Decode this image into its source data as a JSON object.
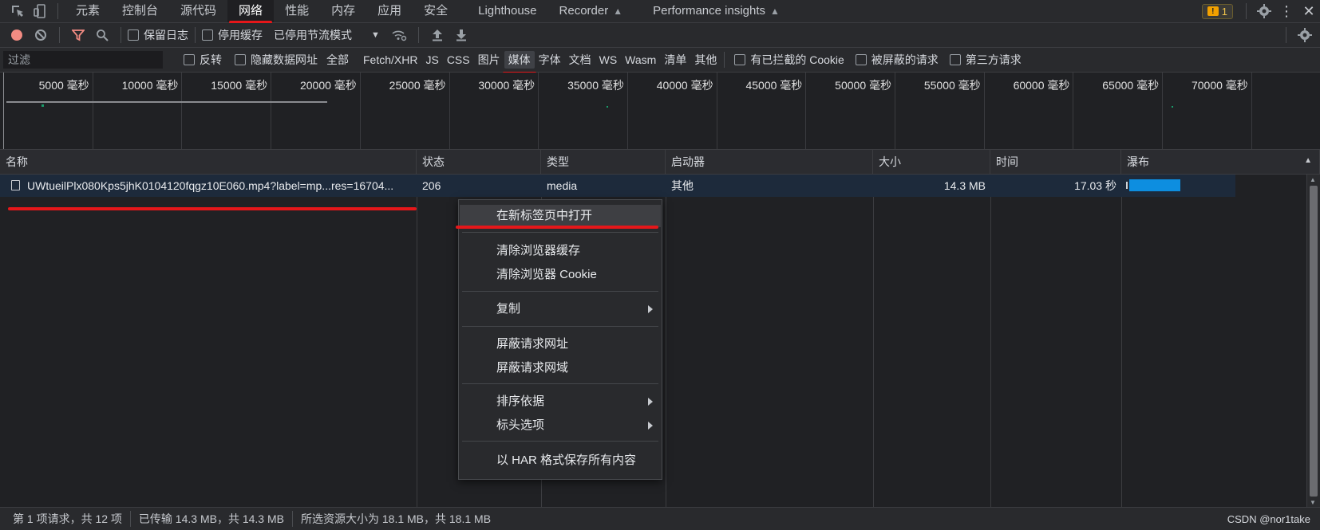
{
  "tabs": [
    "元素",
    "控制台",
    "源代码",
    "网络",
    "性能",
    "内存",
    "应用",
    "安全",
    "Lighthouse",
    "Recorder",
    "Performance insights"
  ],
  "active_tab_index": 3,
  "issues_count": "1",
  "toolbar": {
    "preserve_log": "保留日志",
    "disable_cache": "停用缓存",
    "throttling": "已停用节流模式"
  },
  "filter": {
    "placeholder": "过滤",
    "invert": "反转",
    "hide_data_urls": "隐藏数据网址",
    "types": [
      "全部",
      "Fetch/XHR",
      "JS",
      "CSS",
      "图片",
      "媒体",
      "字体",
      "文档",
      "WS",
      "Wasm",
      "清单",
      "其他"
    ],
    "active_type_index": 5,
    "blocked_cookies": "有已拦截的 Cookie",
    "blocked_requests": "被屏蔽的请求",
    "third_party": "第三方请求"
  },
  "overview": {
    "ticks": [
      "5000 毫秒",
      "10000 毫秒",
      "15000 毫秒",
      "20000 毫秒",
      "25000 毫秒",
      "30000 毫秒",
      "35000 毫秒",
      "40000 毫秒",
      "45000 毫秒",
      "50000 毫秒",
      "55000 毫秒",
      "60000 毫秒",
      "65000 毫秒",
      "70000 毫秒"
    ]
  },
  "table": {
    "columns": [
      "名称",
      "状态",
      "类型",
      "启动器",
      "大小",
      "时间",
      "瀑布"
    ],
    "row": {
      "name": "UWtueilPlx080Kps5jhK0104120fqgz10E060.mp4?label=mp...res=16704...",
      "status": "206",
      "type": "media",
      "initiator": "其他",
      "size": "14.3 MB",
      "time": "17.03 秒"
    }
  },
  "context_menu": {
    "items": [
      "在新标签页中打开",
      "清除浏览器缓存",
      "清除浏览器 Cookie",
      "复制",
      "屏蔽请求网址",
      "屏蔽请求网域",
      "排序依据",
      "标头选项",
      "以 HAR 格式保存所有内容"
    ]
  },
  "status": {
    "requests": "第 1 项请求，共 12 项",
    "transferred": "已传输 14.3 MB，共 14.3 MB",
    "resources": "所选资源大小为 18.1 MB，共 18.1 MB",
    "watermark": "CSDN @nor1take"
  },
  "colors": {
    "accent_red": "#e5171a",
    "waterfall_blue": "#0d8ee0",
    "record_red": "#f28b82"
  }
}
